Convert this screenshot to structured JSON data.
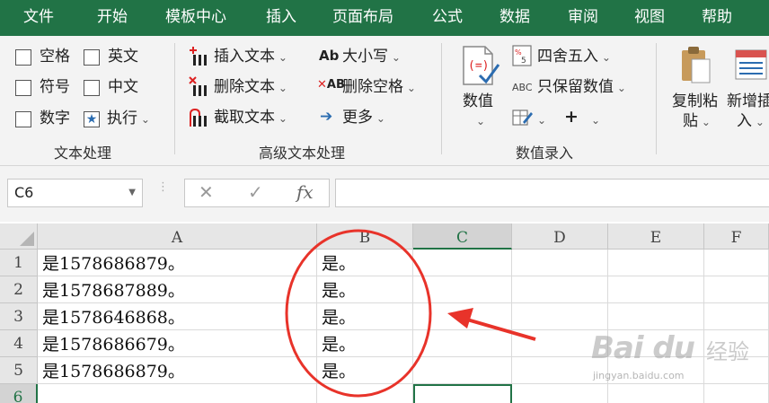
{
  "menu": [
    "文件",
    "开始",
    "模板中心",
    "插入",
    "页面布局",
    "公式",
    "数据",
    "审阅",
    "视图",
    "帮助"
  ],
  "ribbon": {
    "text_group": {
      "checkboxes": [
        "空格",
        "英文",
        "符号",
        "中文",
        "数字"
      ],
      "execute": "执行",
      "label": "文本处理"
    },
    "advanced_group": {
      "insert_text": "插入文本",
      "delete_text": "删除文本",
      "extract_text": "截取文本",
      "case": "大小写",
      "delete_space": "删除空格",
      "more": "更多",
      "label": "高级文本处理"
    },
    "number_group": {
      "numeric": "数值",
      "round": "四舍五入",
      "keep_numeric": "只保留数值",
      "label": "数值录入"
    },
    "copy_paste": {
      "line1": "复制粘",
      "line2": "贴"
    },
    "new_insert": {
      "line1": "新增插",
      "line2": "入"
    }
  },
  "formula_bar": {
    "name_box": "C6",
    "cancel": "✕",
    "confirm": "✓",
    "fx": "fx",
    "value": ""
  },
  "grid": {
    "columns": [
      "A",
      "B",
      "C",
      "D",
      "E",
      "F"
    ],
    "selected_column": "C",
    "rows": [
      {
        "n": "1",
        "a": "是1578686879。",
        "b": "是。"
      },
      {
        "n": "2",
        "a": "是1578687889。",
        "b": "是。"
      },
      {
        "n": "3",
        "a": "是1578646868。",
        "b": "是。"
      },
      {
        "n": "4",
        "a": "是1578686679。",
        "b": "是。"
      },
      {
        "n": "5",
        "a": "是1578686879。",
        "b": "是。"
      },
      {
        "n": "6",
        "a": "",
        "b": ""
      }
    ],
    "selected_row": "6"
  },
  "watermark": {
    "brand": "Bai du",
    "brand_cn": "经验",
    "url": "jingyan.baidu.com"
  },
  "colors": {
    "excel_green": "#217346",
    "annotation_red": "#e8332a"
  }
}
